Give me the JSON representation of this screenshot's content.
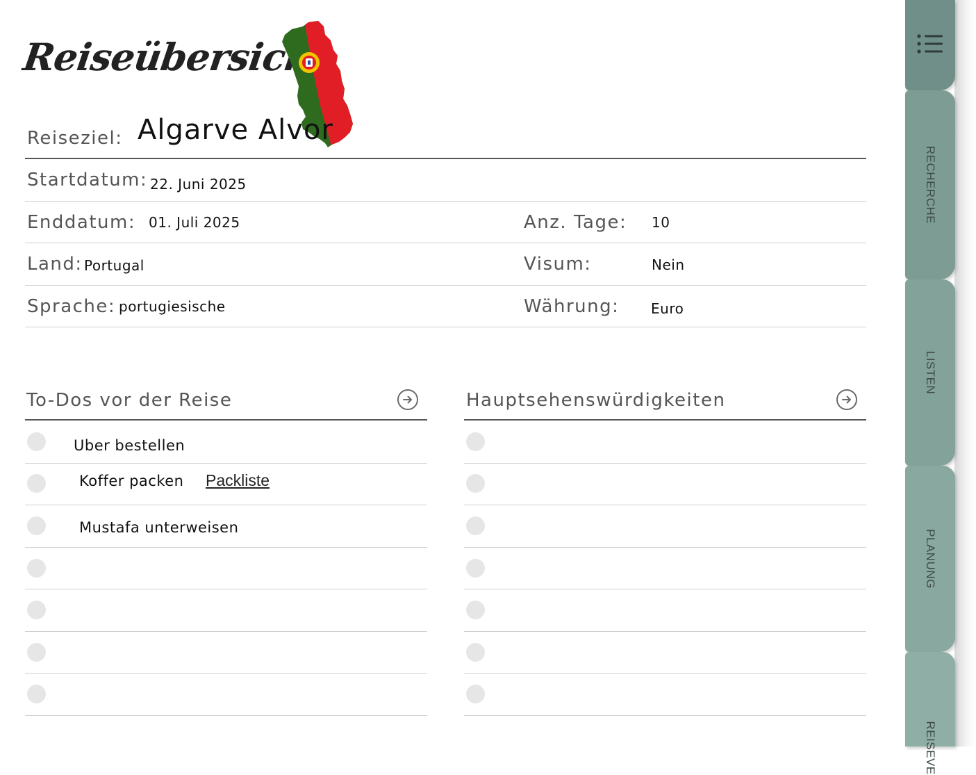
{
  "header": {
    "title": "Reiseübersicht"
  },
  "trip": {
    "destination_label": "Reiseziel:",
    "destination": "Algarve Alvor",
    "start_label": "Startdatum:",
    "start": "22. Juni 2025",
    "end_label": "Enddatum:",
    "end": "01. Juli 2025",
    "days_label": "Anz. Tage:",
    "days": "10",
    "country_label": "Land:",
    "country": "Portugal",
    "visa_label": "Visum:",
    "visa": "Nein",
    "language_label": "Sprache:",
    "language": "portugiesische",
    "currency_label": "Währung:",
    "currency": "Euro"
  },
  "todos": {
    "title": "To-Dos vor der Reise",
    "items": [
      "Uber bestellen",
      "Koffer packen",
      "Mustafa unterweisen",
      "",
      "",
      "",
      ""
    ],
    "link_label": "Packliste"
  },
  "sights": {
    "title": "Hauptsehenswürdigkeiten",
    "items": [
      "",
      "",
      "",
      "",
      "",
      "",
      ""
    ]
  },
  "tabs": {
    "menu": "menu-icon",
    "items": [
      {
        "label": "RECHERCHE",
        "color": "#7d9c94"
      },
      {
        "label": "LISTEN",
        "color": "#82a29a"
      },
      {
        "label": "PLANUNG",
        "color": "#88a8a0"
      },
      {
        "label": "REISEVE",
        "color": "#8eaea6"
      }
    ],
    "top_color": "#6f8f88"
  },
  "flag_colors": {
    "green": "#2e6b1f",
    "red": "#e11e26"
  }
}
